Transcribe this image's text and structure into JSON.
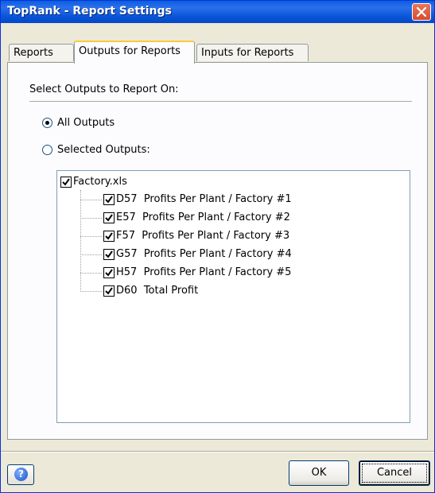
{
  "window": {
    "title": "TopRank - Report Settings"
  },
  "tabs": [
    {
      "label": "Reports"
    },
    {
      "label": "Outputs for Reports",
      "active": true
    },
    {
      "label": "Inputs for Reports"
    }
  ],
  "panel": {
    "section_label": "Select Outputs to Report On:",
    "radio_all": {
      "label": "All Outputs",
      "checked": true
    },
    "radio_selected": {
      "label": "Selected Outputs:",
      "checked": false
    }
  },
  "tree": {
    "root": {
      "label": "Factory.xls",
      "checked": true
    },
    "items": [
      {
        "label": "D57  Profits Per Plant / Factory #1",
        "checked": true
      },
      {
        "label": "E57  Profits Per Plant / Factory #2",
        "checked": true
      },
      {
        "label": "F57  Profits Per Plant / Factory #3",
        "checked": true
      },
      {
        "label": "G57  Profits Per Plant / Factory #4",
        "checked": true
      },
      {
        "label": "H57  Profits Per Plant / Factory #5",
        "checked": true
      },
      {
        "label": "D60  Total Profit",
        "checked": true
      }
    ]
  },
  "buttons": {
    "help_icon": "help-icon",
    "ok": "OK",
    "cancel": "Cancel"
  },
  "colors": {
    "titlebar": "#0A5FE0",
    "dialog_bg": "#ECE9D8",
    "close": "#D44E2E"
  }
}
